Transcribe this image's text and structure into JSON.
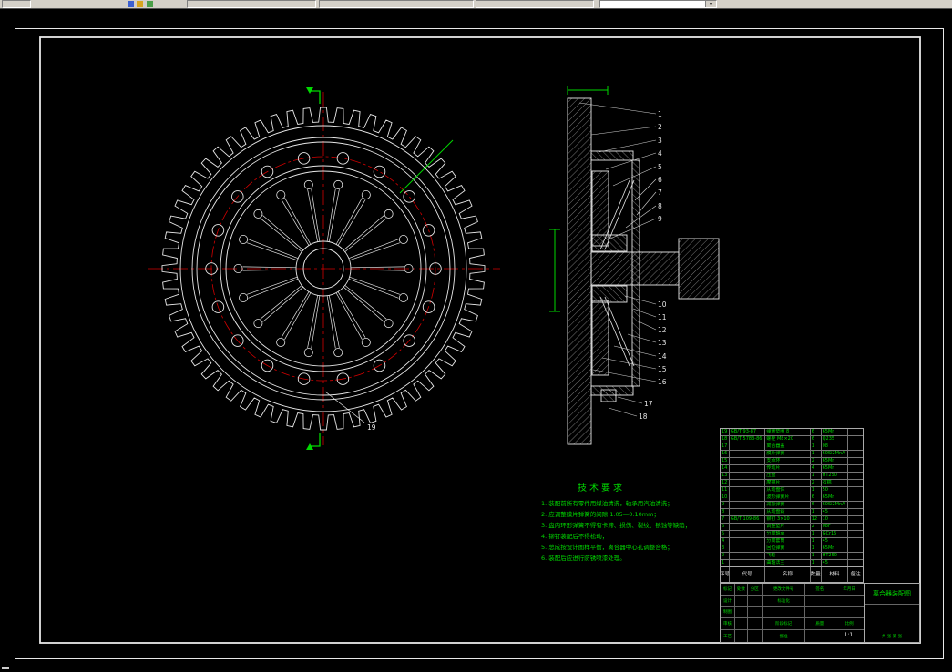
{
  "toolbar": {
    "combo_value": ""
  },
  "colors": {
    "green": "#00d800",
    "red": "#d40000",
    "line": "#e8e8e8"
  },
  "drawing": {
    "part_labels": {
      "front": "19",
      "section_top": [
        "1",
        "2",
        "3",
        "4",
        "5",
        "6",
        "7",
        "8",
        "9"
      ],
      "section_bottom": [
        "10",
        "11",
        "12",
        "13",
        "14",
        "15",
        "16",
        "17",
        "18"
      ]
    },
    "tech_req": {
      "title": "技术要求",
      "lines": [
        "1. 装配前所有零件用煤油清洗，轴承用汽油清洗；",
        "2. 应调整膜片弹簧的间隙 1.05—0.10mm；",
        "3. 盘内环形弹簧不得有卡滞、损伤、裂纹、锈蚀等缺陷；",
        "4. 铆钉装配后不得松动；",
        "5. 总成按设计图样平衡，离合器中心孔调整合格；",
        "6. 装配后应进行防锈喷漆处理。"
      ]
    },
    "bom": {
      "headers": [
        "序号",
        "代号",
        "名称",
        "数量",
        "材料",
        "备注"
      ],
      "rows": [
        [
          "19",
          "GB/T 93-87",
          "弹簧垫圈 8",
          "6",
          "65Mn",
          ""
        ],
        [
          "18",
          "GB/T 5783-86",
          "螺栓 M8×20",
          "6",
          "Q235",
          ""
        ],
        [
          "17",
          "",
          "离合器盖",
          "1",
          "08",
          ""
        ],
        [
          "16",
          "",
          "膜片弹簧",
          "1",
          "60Si2MnA",
          ""
        ],
        [
          "15",
          "",
          "支承环",
          "2",
          "65Mn",
          ""
        ],
        [
          "14",
          "",
          "传动片",
          "4",
          "65Mn",
          ""
        ],
        [
          "13",
          "",
          "压盘",
          "1",
          "HT250",
          ""
        ],
        [
          "12",
          "",
          "摩擦片",
          "2",
          "石棉",
          ""
        ],
        [
          "11",
          "",
          "从动盘体",
          "1",
          "50",
          ""
        ],
        [
          "10",
          "",
          "波形弹簧片",
          "6",
          "65Mn",
          ""
        ],
        [
          "9",
          "",
          "减振弹簧",
          "6",
          "60Si2MnA",
          ""
        ],
        [
          "8",
          "",
          "从动盘毂",
          "1",
          "45",
          ""
        ],
        [
          "7",
          "GB/T 109-86",
          "铆钉 3×10",
          "12",
          "10",
          ""
        ],
        [
          "6",
          "",
          "调整垫片",
          "2",
          "08F",
          ""
        ],
        [
          "5",
          "",
          "分离轴承",
          "1",
          "GCr15",
          ""
        ],
        [
          "4",
          "",
          "分离套筒",
          "1",
          "45",
          ""
        ],
        [
          "3",
          "",
          "回位弹簧",
          "1",
          "65Mn",
          ""
        ],
        [
          "2",
          "",
          "飞轮",
          "1",
          "HT250",
          ""
        ],
        [
          "1",
          "",
          "曲轴法兰",
          "1",
          "45",
          ""
        ]
      ]
    },
    "title_block": {
      "drawing_title": "离合器装配图",
      "scale_value": "1:1",
      "sheet_note": "共 张  第 张",
      "left_rows": [
        [
          "标记",
          "处数",
          "分区",
          "更改文件号",
          "签名",
          "年月日"
        ],
        [
          "设计",
          "",
          "",
          "标准化",
          "",
          ""
        ],
        [
          "制图",
          "",
          "",
          "",
          "",
          ""
        ],
        [
          "审核",
          "",
          "",
          "阶段标记",
          "质量",
          "比例"
        ],
        [
          "工艺",
          "",
          "",
          "批准",
          "",
          ""
        ]
      ]
    }
  }
}
